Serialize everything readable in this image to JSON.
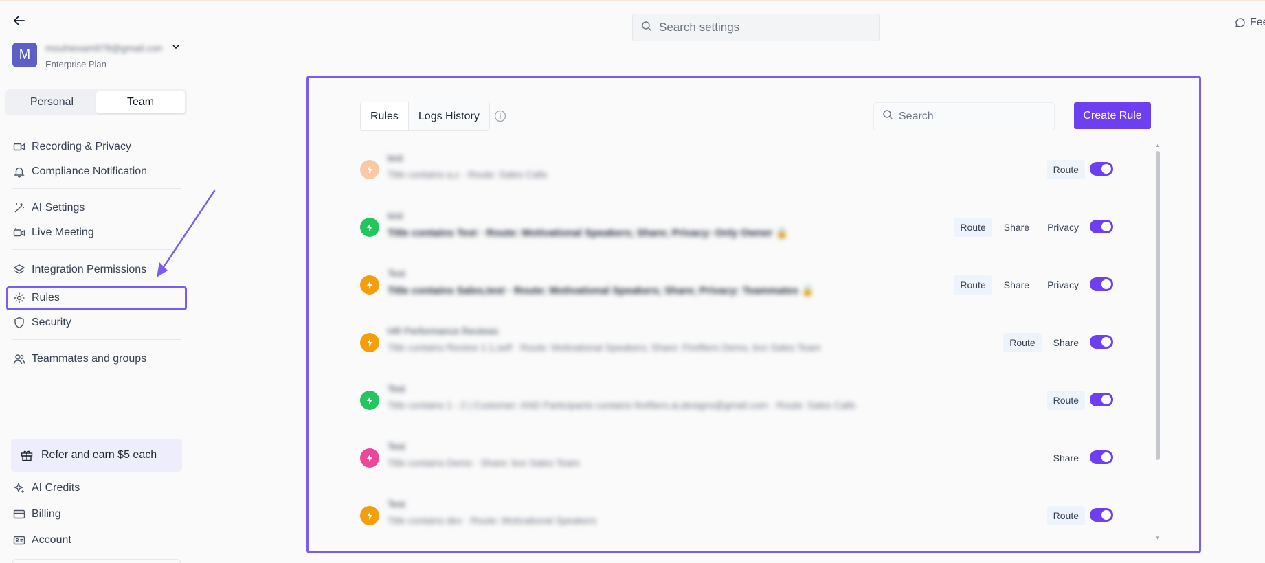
{
  "colors": {
    "accent": "#6d3ff0",
    "highlight": "#7c5cf0",
    "avatar": "#5b5fc7"
  },
  "account": {
    "avatar_letter": "M",
    "email": "mouhiexam978@gmail.com",
    "plan": "Enterprise Plan"
  },
  "segment": {
    "personal": "Personal",
    "team": "Team",
    "active": "Team"
  },
  "sidebar": {
    "recording_privacy": "Recording & Privacy",
    "compliance_notification": "Compliance Notification",
    "ai_settings": "AI Settings",
    "live_meeting": "Live Meeting",
    "integration_permissions": "Integration Permissions",
    "rules": "Rules",
    "security": "Security",
    "teammates_groups": "Teammates and groups",
    "refer": "Refer and earn $5 each",
    "ai_credits": "AI Credits",
    "billing": "Billing",
    "account": "Account"
  },
  "top": {
    "search_placeholder": "Search settings",
    "feedback": "Feedback"
  },
  "panel": {
    "tabs": [
      "Rules",
      "Logs History"
    ],
    "search_placeholder": "Search",
    "create_button": "Create Rule"
  },
  "rules": [
    {
      "name": "test",
      "desc": "Title contains a,c · Route: Sales Calls",
      "icon_color": "#f8c9a4",
      "tags": [
        "Route"
      ],
      "enabled": true,
      "dark": false
    },
    {
      "name": "test",
      "desc": "Title contains Test · Route: Motivational Speakers; Share; Privacy: Only Owner 🔒",
      "icon_color": "#22c55e",
      "tags": [
        "Route",
        "Share",
        "Privacy"
      ],
      "enabled": true,
      "dark": true
    },
    {
      "name": "Test",
      "desc": "Title contains Sales,test · Route: Motivational Speakers; Share; Privacy: Teammates 🔒",
      "icon_color": "#f59e0b",
      "tags": [
        "Route",
        "Share",
        "Privacy"
      ],
      "enabled": true,
      "dark": true
    },
    {
      "name": "HR Performance Reviews",
      "desc": "Title contains Review 1:1,self · Route: Motivational Speakers; Share: Firefliers Demo, bvx Sales Team",
      "icon_color": "#f59e0b",
      "tags": [
        "Route",
        "Share"
      ],
      "enabled": true,
      "dark": false
    },
    {
      "name": "Test",
      "desc": "Title contains 1 - 2 | Customer: AND Participants contains firefliers.ai,designs@gmail.com · Route: Sales Calls",
      "icon_color": "#22c55e",
      "tags": [
        "Route"
      ],
      "enabled": true,
      "dark": false
    },
    {
      "name": "Test",
      "desc": "Title contains Demo · Share: bvx Sales Team",
      "icon_color": "#ec4899",
      "tags": [
        "Share"
      ],
      "enabled": true,
      "dark": false
    },
    {
      "name": "Test",
      "desc": "Title contains dev · Route: Motivational Speakers",
      "icon_color": "#f59e0b",
      "tags": [
        "Route"
      ],
      "enabled": true,
      "dark": false
    }
  ]
}
